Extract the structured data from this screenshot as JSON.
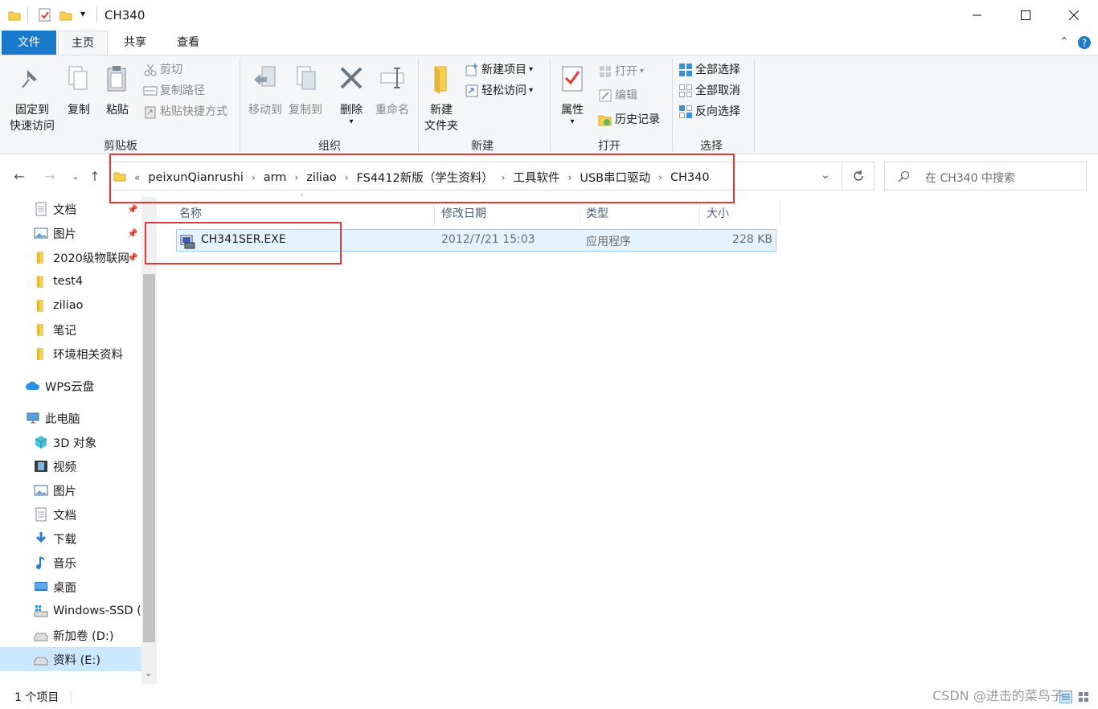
{
  "window": {
    "title": "CH340"
  },
  "tabs": {
    "file": "文件",
    "home": "主页",
    "share": "共享",
    "view": "查看"
  },
  "ribbon": {
    "clipboard": {
      "label": "剪贴板",
      "pin_line1": "固定到",
      "pin_line2": "快速访问",
      "copy": "复制",
      "paste": "粘贴",
      "cut": "剪切",
      "copy_path": "复制路径",
      "paste_shortcut": "粘贴快捷方式"
    },
    "organize": {
      "label": "组织",
      "move_to": "移动到",
      "copy_to": "复制到",
      "delete": "删除",
      "rename": "重命名"
    },
    "new": {
      "label": "新建",
      "new_folder_line1": "新建",
      "new_folder_line2": "文件夹",
      "new_item": "新建项目",
      "easy_access": "轻松访问"
    },
    "open": {
      "label": "打开",
      "properties": "属性",
      "open": "打开",
      "edit": "编辑",
      "history": "历史记录"
    },
    "select": {
      "label": "选择",
      "select_all": "全部选择",
      "select_none": "全部取消",
      "invert": "反向选择"
    }
  },
  "address": {
    "prefix": "«",
    "crumbs": [
      "peixunQianrushi",
      "arm",
      "ziliao",
      "FS4412新版（学生资料）",
      "工具软件",
      "USB串口驱动",
      "CH340"
    ]
  },
  "search": {
    "placeholder": "在 CH340 中搜索"
  },
  "sidebar": {
    "items": [
      "文档",
      "图片",
      "2020级物联网",
      "test4",
      "ziliao",
      "笔记",
      "环境相关资料",
      "WPS云盘",
      "此电脑",
      "3D 对象",
      "视频",
      "图片",
      "文档",
      "下载",
      "音乐",
      "桌面",
      "Windows-SSD (",
      "新加卷 (D:)",
      "资料 (E:)"
    ]
  },
  "columns": {
    "name": "名称",
    "modified": "修改日期",
    "type": "类型",
    "size": "大小"
  },
  "files": [
    {
      "name": "CH341SER.EXE",
      "modified": "2012/7/21 15:03",
      "type": "应用程序",
      "size": "228 KB"
    }
  ],
  "status": {
    "count": "1 个项目"
  },
  "watermark": "CSDN @进击的菜鸟子",
  "colors": {
    "accent": "#1979ca",
    "highlight": "#e0373a",
    "selection": "#cce8ff"
  }
}
